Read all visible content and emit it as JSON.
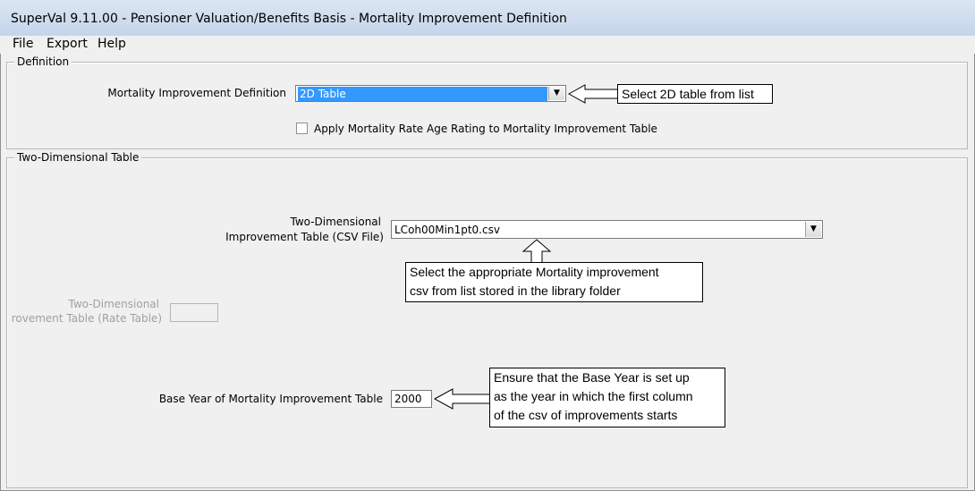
{
  "window": {
    "title": "SuperVal  9.11.00 - Pensioner Valuation/Benefits Basis - Mortality Improvement Definition"
  },
  "menu": [
    "File",
    "Export",
    "Help"
  ],
  "definition": {
    "group_label": "Definition",
    "mi_label": "Mortality Improvement Definition",
    "mi_value": "2D Table",
    "apply_label": "Apply Mortality Rate Age Rating to Mortality Improvement Table",
    "apply_checked": false
  },
  "two_dim": {
    "group_label": "Two-Dimensional Table",
    "csv_label_line1": "Two-Dimensional",
    "csv_label_line2": "Improvement Table (CSV File)",
    "csv_value": "LCoh00Min1pt0.csv",
    "rate_label_line1": "Two-Dimensional",
    "rate_label_line2": "rovement Table (Rate Table)",
    "rate_value": "",
    "base_year_label": "Base Year of Mortality Improvement Table",
    "base_year_value": "2000"
  },
  "callouts": {
    "select_2d": "Select 2D table from list",
    "select_csv_line1": "Select the appropriate Mortality improvement",
    "select_csv_line2": "csv from list stored in the library folder",
    "base_year_line1": "Ensure that the Base Year is set up",
    "base_year_line2": "as the year in which the first column",
    "base_year_line3": "of the csv of improvements starts"
  }
}
